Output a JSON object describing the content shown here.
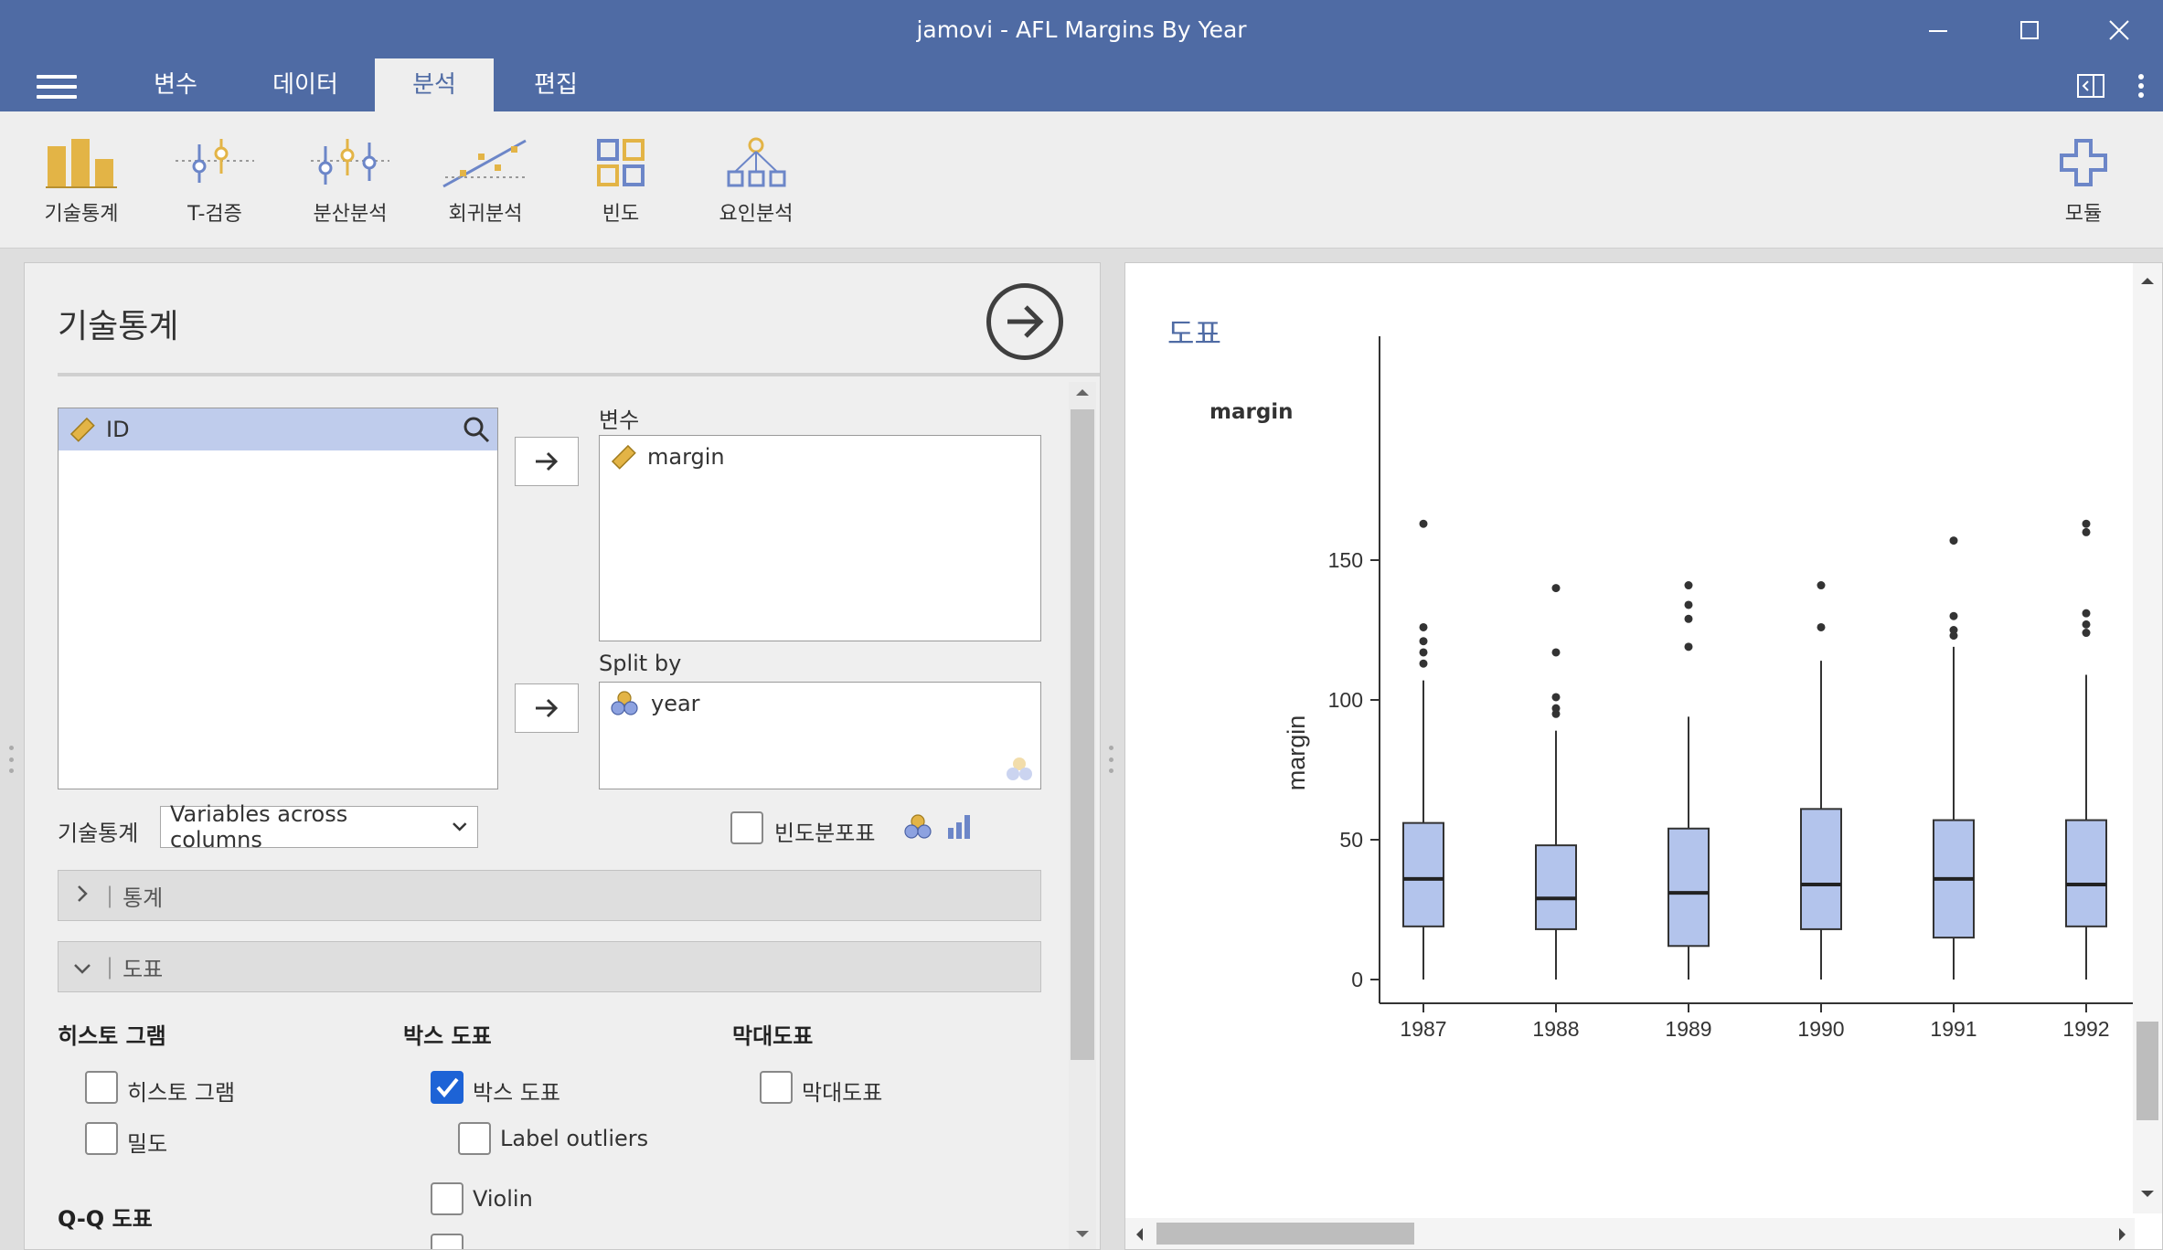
{
  "window": {
    "title": "jamovi - AFL Margins By Year"
  },
  "menu": {
    "tabs": [
      {
        "label": "변수"
      },
      {
        "label": "데이터"
      },
      {
        "label": "분석"
      },
      {
        "label": "편집"
      }
    ],
    "active_tab": "분석"
  },
  "ribbon": {
    "items": [
      {
        "label": "기술통계",
        "icon": "bar-chart-icon"
      },
      {
        "label": "T-검증",
        "icon": "t-test-icon"
      },
      {
        "label": "분산분석",
        "icon": "anova-icon"
      },
      {
        "label": "회귀분석",
        "icon": "regression-icon"
      },
      {
        "label": "빈도",
        "icon": "frequencies-icon"
      },
      {
        "label": "요인분석",
        "icon": "factor-icon"
      }
    ],
    "modules_label": "모듈"
  },
  "options": {
    "title": "기술통계",
    "source_variables": [
      "ID"
    ],
    "variables_label": "변수",
    "variables": [
      "margin"
    ],
    "split_by_label": "Split by",
    "split_by": [
      "year"
    ],
    "descriptives_label": "기술통계",
    "descriptives_layout": "Variables across columns",
    "freq_table_label": "빈도분포표",
    "sections": {
      "stats": "통계",
      "plots": "도표"
    },
    "plots": {
      "histogram_header": "히스토 그램",
      "histogram": "히스토 그램",
      "density": "밀도",
      "box_header": "박스 도표",
      "box": "박스 도표",
      "label_outliers": "Label outliers",
      "violin": "Violin",
      "bar_header": "막대도표",
      "bar": "막대도표",
      "qq_header": "Q-Q 도표"
    }
  },
  "results": {
    "title": "도표",
    "subtitle": "margin"
  },
  "chart_data": {
    "type": "box",
    "ylabel": "margin",
    "ylim": [
      0,
      170
    ],
    "yticks": [
      0,
      50,
      100,
      150
    ],
    "categories": [
      "1987",
      "1988",
      "1989",
      "1990",
      "1991",
      "1992"
    ],
    "boxes": [
      {
        "category": "1987",
        "q1": 19,
        "median": 36,
        "q3": 56,
        "whisker_low": 0,
        "whisker_high": 107,
        "outliers": [
          113,
          117,
          121,
          126,
          163
        ]
      },
      {
        "category": "1988",
        "q1": 18,
        "median": 29,
        "q3": 48,
        "whisker_low": 0,
        "whisker_high": 89,
        "outliers": [
          95,
          97,
          101,
          117,
          140
        ]
      },
      {
        "category": "1989",
        "q1": 12,
        "median": 31,
        "q3": 54,
        "whisker_low": 0,
        "whisker_high": 94,
        "outliers": [
          119,
          129,
          134,
          141
        ]
      },
      {
        "category": "1990",
        "q1": 18,
        "median": 34,
        "q3": 61,
        "whisker_low": 0,
        "whisker_high": 114,
        "outliers": [
          126,
          141
        ]
      },
      {
        "category": "1991",
        "q1": 15,
        "median": 36,
        "q3": 57,
        "whisker_low": 0,
        "whisker_high": 119,
        "outliers": [
          123,
          125,
          130,
          157
        ]
      },
      {
        "category": "1992",
        "q1": 19,
        "median": 34,
        "q3": 57,
        "whisker_low": 0,
        "whisker_high": 109,
        "outliers": [
          124,
          127,
          131,
          160,
          163
        ]
      }
    ],
    "colors": {
      "box_fill": "#b3c4ec",
      "box_stroke": "#333333"
    }
  },
  "colors": {
    "accent": "#4f6ba4",
    "checkbox": "#1d63d6",
    "ordinal_icon": "#e3b446"
  }
}
